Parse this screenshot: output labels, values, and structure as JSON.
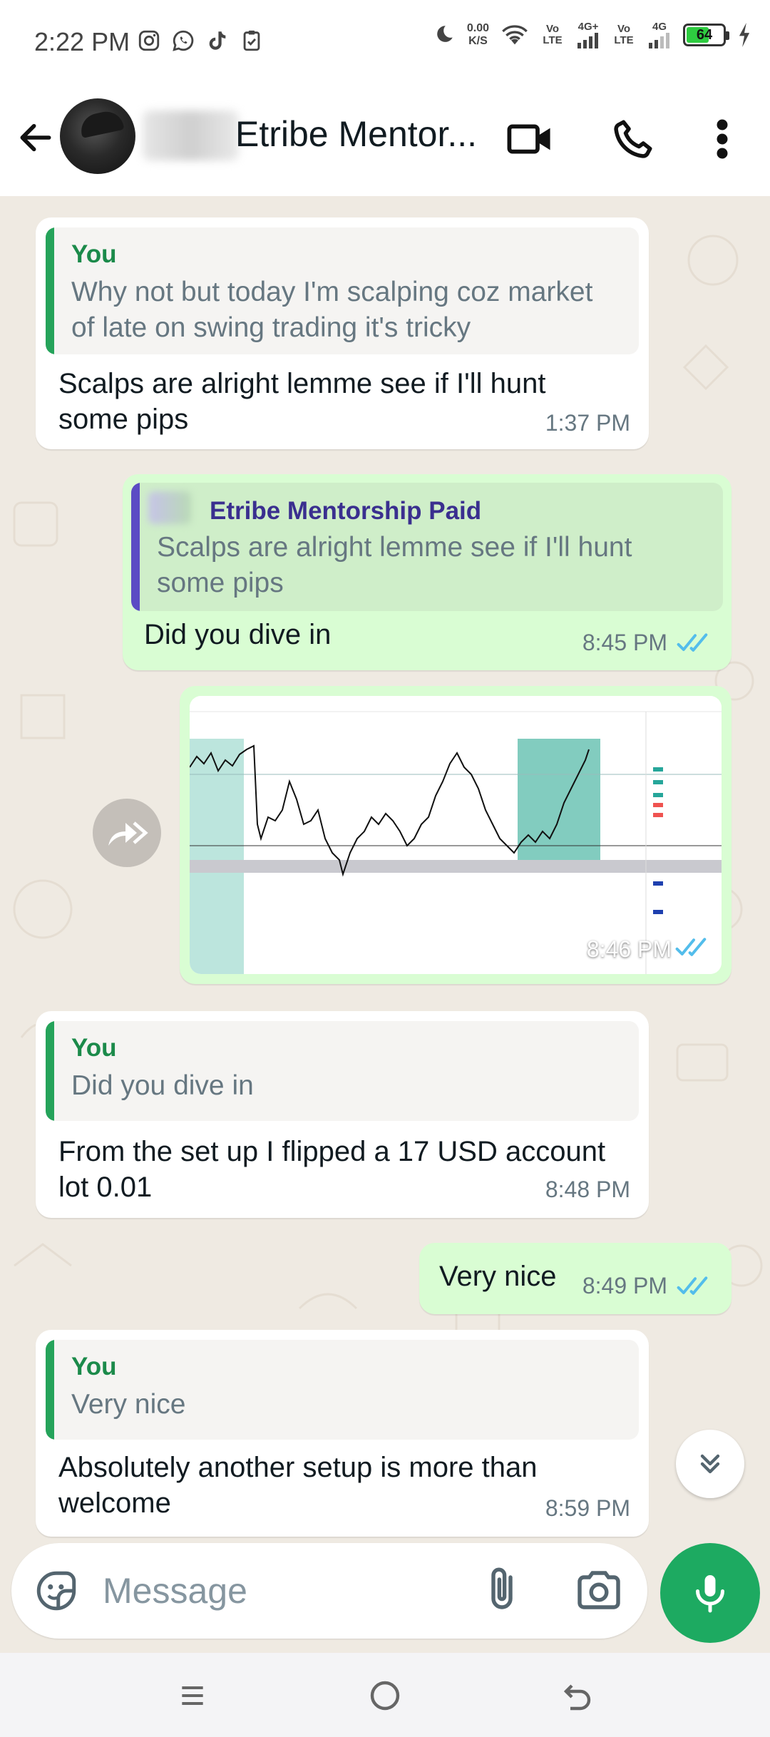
{
  "status_bar": {
    "time": "2:22 PM",
    "speed_value": "0.00",
    "speed_unit": "K/S",
    "network_1": "Vo LTE",
    "network_1_gen": "4G+",
    "network_2": "Vo LTE",
    "network_2_gen": "4G",
    "battery": "64",
    "battery_level": 0.64,
    "icons": [
      "moon-icon",
      "wifi-icon",
      "signal-icon",
      "charging-icon",
      "instagram-icon",
      "whatsapp-icon",
      "tiktok-icon",
      "clipboard-icon"
    ]
  },
  "header": {
    "contact_name": "Etribe Mentor...",
    "icons": [
      "back-arrow-icon",
      "video-call-icon",
      "phone-icon",
      "more-vert-icon"
    ]
  },
  "messages": [
    {
      "direction": "in",
      "quote_author": "You",
      "quote_text": "Why not but today I'm scalping coz market of late on swing trading it's tricky",
      "text": "Scalps are alright lemme see if I'll hunt some pips",
      "time": "1:37 PM"
    },
    {
      "direction": "out",
      "quote_author": "Etribe Mentorship Paid",
      "quote_text": "Scalps are alright lemme see if I'll hunt some pips",
      "text": "Did you dive in",
      "time": "8:45 PM",
      "read": true
    },
    {
      "direction": "out",
      "type": "image",
      "time": "8:46 PM",
      "read": true
    },
    {
      "direction": "in",
      "quote_author": "You",
      "quote_text": "Did you dive in",
      "text": "From the set up I flipped a 17 USD account lot 0.01",
      "time": "8:48 PM"
    },
    {
      "direction": "out",
      "text": "Very nice",
      "time": "8:49 PM",
      "read": true
    },
    {
      "direction": "in",
      "quote_author": "You",
      "quote_text": "Very nice",
      "text": "Absolutely another setup is more than welcome",
      "time": "8:59 PM"
    }
  ],
  "composer": {
    "placeholder": "Message",
    "icons": [
      "sticker-icon",
      "attach-icon",
      "camera-icon",
      "mic-icon"
    ]
  },
  "colors": {
    "accent_green": "#1daa61",
    "incoming_bubble": "#ffffff",
    "outgoing_bubble": "#d9fdd3",
    "read_ticks": "#53bdeb",
    "quote_you": "#1b8a4a",
    "quote_other": "#3a2f8f"
  }
}
